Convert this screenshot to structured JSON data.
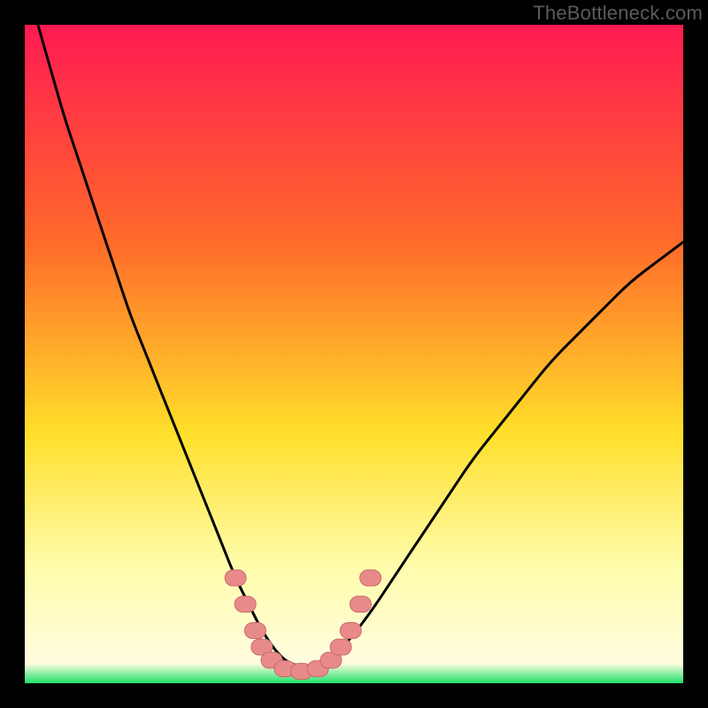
{
  "watermark": "TheBottleneck.com",
  "colors": {
    "bg": "#000000",
    "grad_top": "#ff1a52",
    "grad_mid1": "#ff6a2a",
    "grad_mid2": "#ffdf2a",
    "grad_low": "#fffcaa",
    "grad_base": "#1fe06a",
    "curve": "#000000",
    "marker_fill": "#e98a8a",
    "marker_stroke": "#c96a6a"
  },
  "chart_data": {
    "type": "line",
    "title": "",
    "xlabel": "",
    "ylabel": "",
    "xlim": [
      0,
      100
    ],
    "ylim": [
      0,
      100
    ],
    "series": [
      {
        "name": "bottleneck-curve",
        "x": [
          2,
          4,
          6,
          8,
          10,
          12,
          14,
          16,
          18,
          20,
          22,
          24,
          26,
          28,
          30,
          32,
          34,
          36,
          38,
          40,
          44,
          48,
          52,
          56,
          60,
          64,
          68,
          72,
          76,
          80,
          84,
          88,
          92,
          96,
          100
        ],
        "y": [
          100,
          93,
          86,
          80,
          74,
          68,
          62,
          56,
          51,
          46,
          41,
          36,
          31,
          26,
          21,
          16,
          12,
          8,
          5,
          3,
          2,
          5,
          10,
          16,
          22,
          28,
          34,
          39,
          44,
          49,
          53,
          57,
          61,
          64,
          67
        ]
      }
    ],
    "markers": [
      {
        "x": 32,
        "y": 16
      },
      {
        "x": 33.5,
        "y": 12
      },
      {
        "x": 35,
        "y": 8
      },
      {
        "x": 36,
        "y": 5.5
      },
      {
        "x": 37.5,
        "y": 3.5
      },
      {
        "x": 39.5,
        "y": 2.2
      },
      {
        "x": 42,
        "y": 1.8
      },
      {
        "x": 44.5,
        "y": 2.2
      },
      {
        "x": 46.5,
        "y": 3.5
      },
      {
        "x": 48,
        "y": 5.5
      },
      {
        "x": 49.5,
        "y": 8
      },
      {
        "x": 51,
        "y": 12
      },
      {
        "x": 52.5,
        "y": 16
      }
    ],
    "notch": {
      "x_min": 0.3,
      "x_bottom_left": 0.38,
      "x_bottom_right": 0.47
    }
  }
}
